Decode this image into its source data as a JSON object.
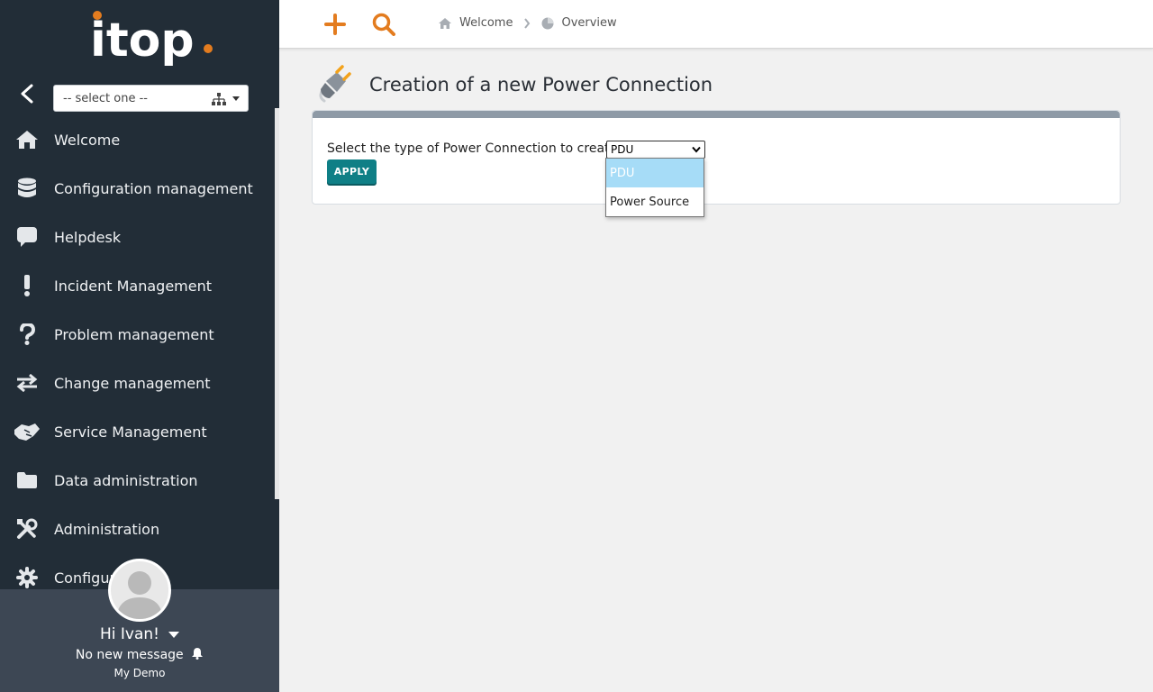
{
  "app": {
    "logo_text": "itop"
  },
  "sidebar": {
    "org_select": {
      "value": "-- select one --"
    },
    "items": [
      {
        "label": "Welcome",
        "icon": "home-icon"
      },
      {
        "label": "Configuration management",
        "icon": "database-icon"
      },
      {
        "label": "Helpdesk",
        "icon": "comment-icon"
      },
      {
        "label": "Incident Management",
        "icon": "exclamation-icon"
      },
      {
        "label": "Problem management",
        "icon": "question-icon"
      },
      {
        "label": "Change management",
        "icon": "exchange-icon"
      },
      {
        "label": "Service Management",
        "icon": "handshake-icon"
      },
      {
        "label": "Data administration",
        "icon": "folder-icon"
      },
      {
        "label": "Administration",
        "icon": "tools-icon"
      },
      {
        "label": "Configur",
        "icon": "gear-icon"
      }
    ]
  },
  "user": {
    "greeting": "Hi Ivan!",
    "messages": "No new message",
    "environment": "My Demo"
  },
  "topbar": {
    "breadcrumb": [
      {
        "label": "Welcome",
        "icon": "home-icon"
      },
      {
        "label": "Overview",
        "icon": "pie-chart-icon"
      }
    ]
  },
  "page": {
    "title": "Creation of a new Power Connection",
    "form": {
      "label": "Select the type of Power Connection to create:",
      "selected": "PDU",
      "options": [
        "PDU",
        "Power Source"
      ],
      "apply_label": "APPLY"
    }
  },
  "colors": {
    "sidebar_bg": "#222d37",
    "user_panel_bg": "#3d4754",
    "accent_orange": "#e37c1f",
    "apply_teal": "#0f7f86",
    "option_highlight": "#a6dcf7"
  }
}
